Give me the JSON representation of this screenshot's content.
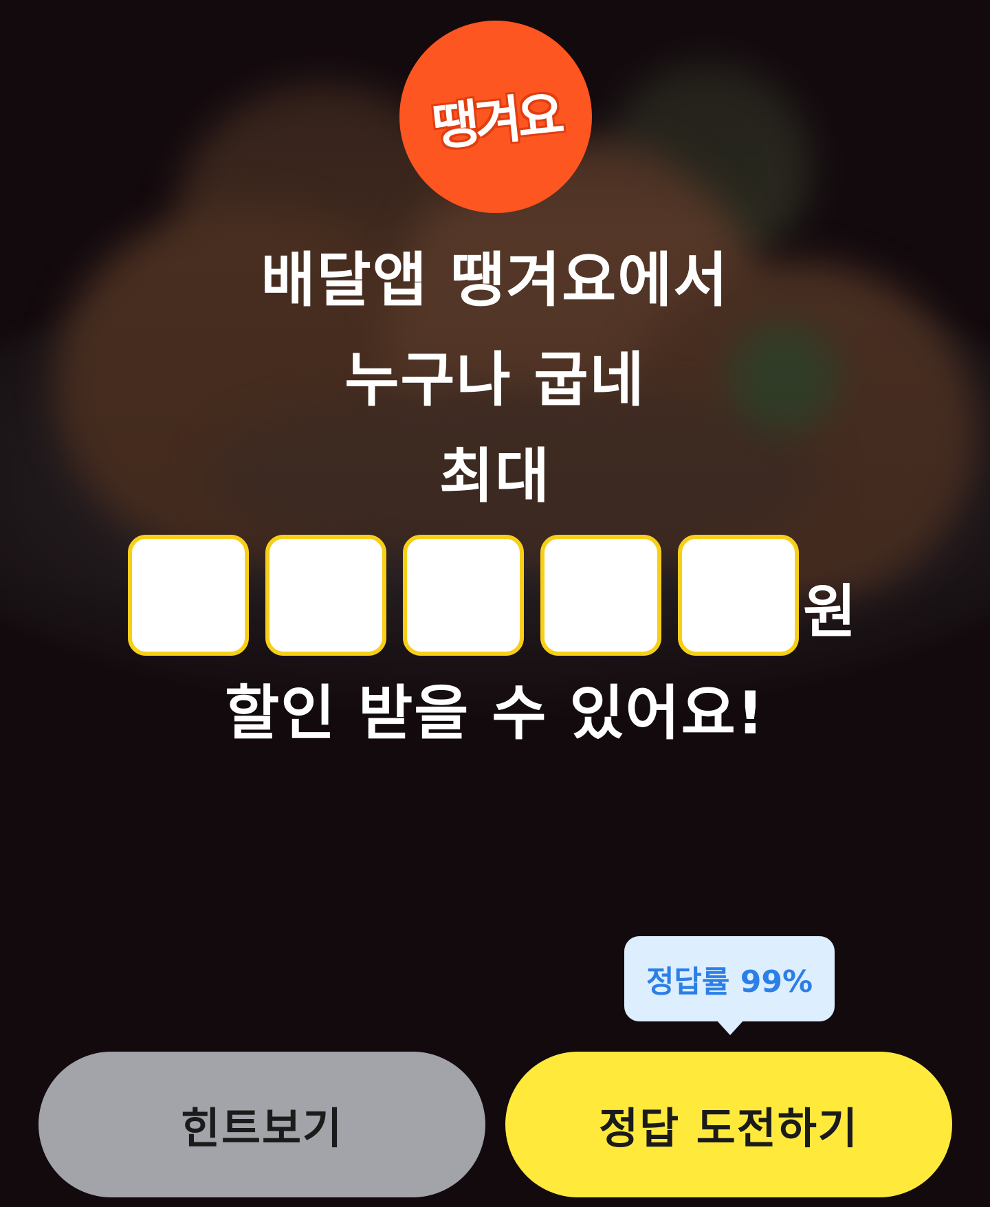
{
  "logo": {
    "text": "땡겨요"
  },
  "headline": {
    "line1": "배달앱 땡겨요에서",
    "line2": "누구나 굽네",
    "line3": "최대",
    "unit": "원",
    "line5": "할인 받을 수 있어요!"
  },
  "answer": {
    "slots": [
      "",
      "",
      "",
      "",
      ""
    ],
    "slot_border_color": "#f7cf19"
  },
  "tooltip": {
    "text": "정답률 99%"
  },
  "buttons": {
    "hint_label": "힌트보기",
    "answer_label": "정답 도전하기"
  },
  "colors": {
    "logo_bg": "#fd5620",
    "hint_button": "#a2a4a9",
    "answer_button": "#ffea3c",
    "tooltip_bg": "#ddeefe",
    "tooltip_text": "#2b7fe6"
  }
}
